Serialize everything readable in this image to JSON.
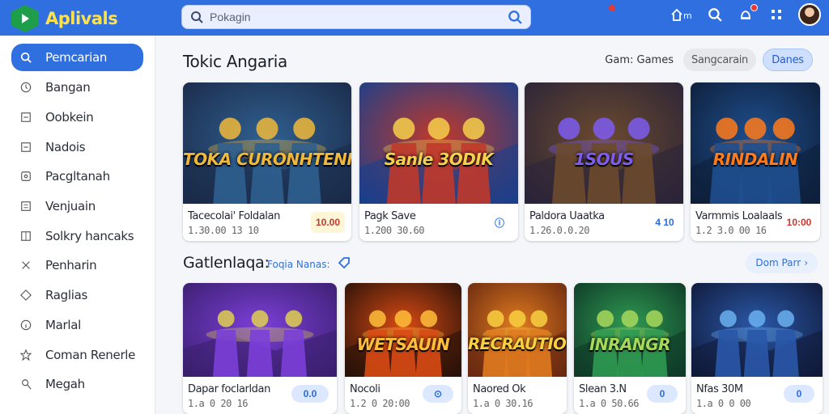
{
  "app": {
    "name": "Aplivals"
  },
  "search": {
    "placeholder": "Pokagin"
  },
  "header_icons": [
    "home-icon",
    "search-icon",
    "bell-icon",
    "grid-icon",
    "avatar"
  ],
  "sidebar": {
    "items": [
      {
        "label": "Pemcarian",
        "icon": "search-icon",
        "active": true
      },
      {
        "label": "Bangan",
        "icon": "clock-icon"
      },
      {
        "label": "Oobkein",
        "icon": "square-icon"
      },
      {
        "label": "Nadois",
        "icon": "square-icon"
      },
      {
        "label": "Pacgltanah",
        "icon": "image-icon"
      },
      {
        "label": "Venjuain",
        "icon": "list-icon"
      },
      {
        "label": "Solkry hancaks",
        "icon": "grid-icon"
      },
      {
        "label": "Penharin",
        "icon": "tools-icon"
      },
      {
        "label": "Raglias",
        "icon": "puzzle-icon"
      },
      {
        "label": "Marlal",
        "icon": "info-icon"
      },
      {
        "label": "Coman Renerle",
        "icon": "star-icon"
      },
      {
        "label": "Megah",
        "icon": "user-icon"
      }
    ]
  },
  "main": {
    "heading": "Tokic Angaria",
    "filter_label": "Gam: Games",
    "filter_chips": [
      "Sangcarain",
      "Danes"
    ],
    "featured": [
      {
        "title": "Tacecolai' Foldalan",
        "sub": "1.30.00 13 10",
        "badge": "10.00",
        "art_text": "TOKA CURONHTENN",
        "colors": [
          "#1b2b4a",
          "#2f5f8f",
          "#f0b83a"
        ]
      },
      {
        "title": "Pagk Save",
        "sub": "1.200 30.60",
        "badge": "ⓘ",
        "art_text": "Sanle 3ODIK",
        "colors": [
          "#1c3f8a",
          "#c0392b",
          "#f5d04a"
        ]
      },
      {
        "title": "Paldora Uaatka",
        "sub": "1.26.0.0.20",
        "badge": "4 10",
        "art_text": "1SOUS",
        "colors": [
          "#2b2438",
          "#6b4a2e",
          "#7e5cf0"
        ]
      },
      {
        "title": "Varmmis Loalaals",
        "sub": "1.2 3.0 00 16",
        "badge": "10:00",
        "art_text": "RINDALIN",
        "colors": [
          "#0e1f3a",
          "#1f4f8f",
          "#ff7a1a"
        ]
      }
    ],
    "section2": {
      "heading": "Gatlenlaqa:",
      "link": "Foqia Nanas:",
      "see_more": "Dom Parr"
    },
    "grid": [
      {
        "title": "Dapar foclarldan",
        "sub": "1.a 0 20 16",
        "badge": "0.0",
        "art_text": "",
        "colors": [
          "#3b1f6e",
          "#7b3fd8",
          "#e0d050"
        ]
      },
      {
        "title": "Nocoli",
        "sub": "1.2 0 20:00",
        "badge": "⊙",
        "art_text": "WETSAUIN",
        "colors": [
          "#2a1208",
          "#d84a14",
          "#ffbe3a"
        ]
      },
      {
        "title": "Naored Ok",
        "sub": "1.a 0 30.16",
        "badge": "",
        "art_text": "RECRAUTION",
        "colors": [
          "#6a2a10",
          "#e07a20",
          "#f8d040"
        ]
      },
      {
        "title": "Slean 3.N",
        "sub": "1.a 0 50.66",
        "badge": "0",
        "art_text": "INRANGR",
        "colors": [
          "#0f3a28",
          "#2f9a52",
          "#a8d85a"
        ]
      },
      {
        "title": "Nfas 30M",
        "sub": "1.a 0 0 00",
        "badge": "0",
        "art_text": "",
        "colors": [
          "#101a3a",
          "#2a58a8",
          "#6ab0f0"
        ]
      }
    ]
  }
}
